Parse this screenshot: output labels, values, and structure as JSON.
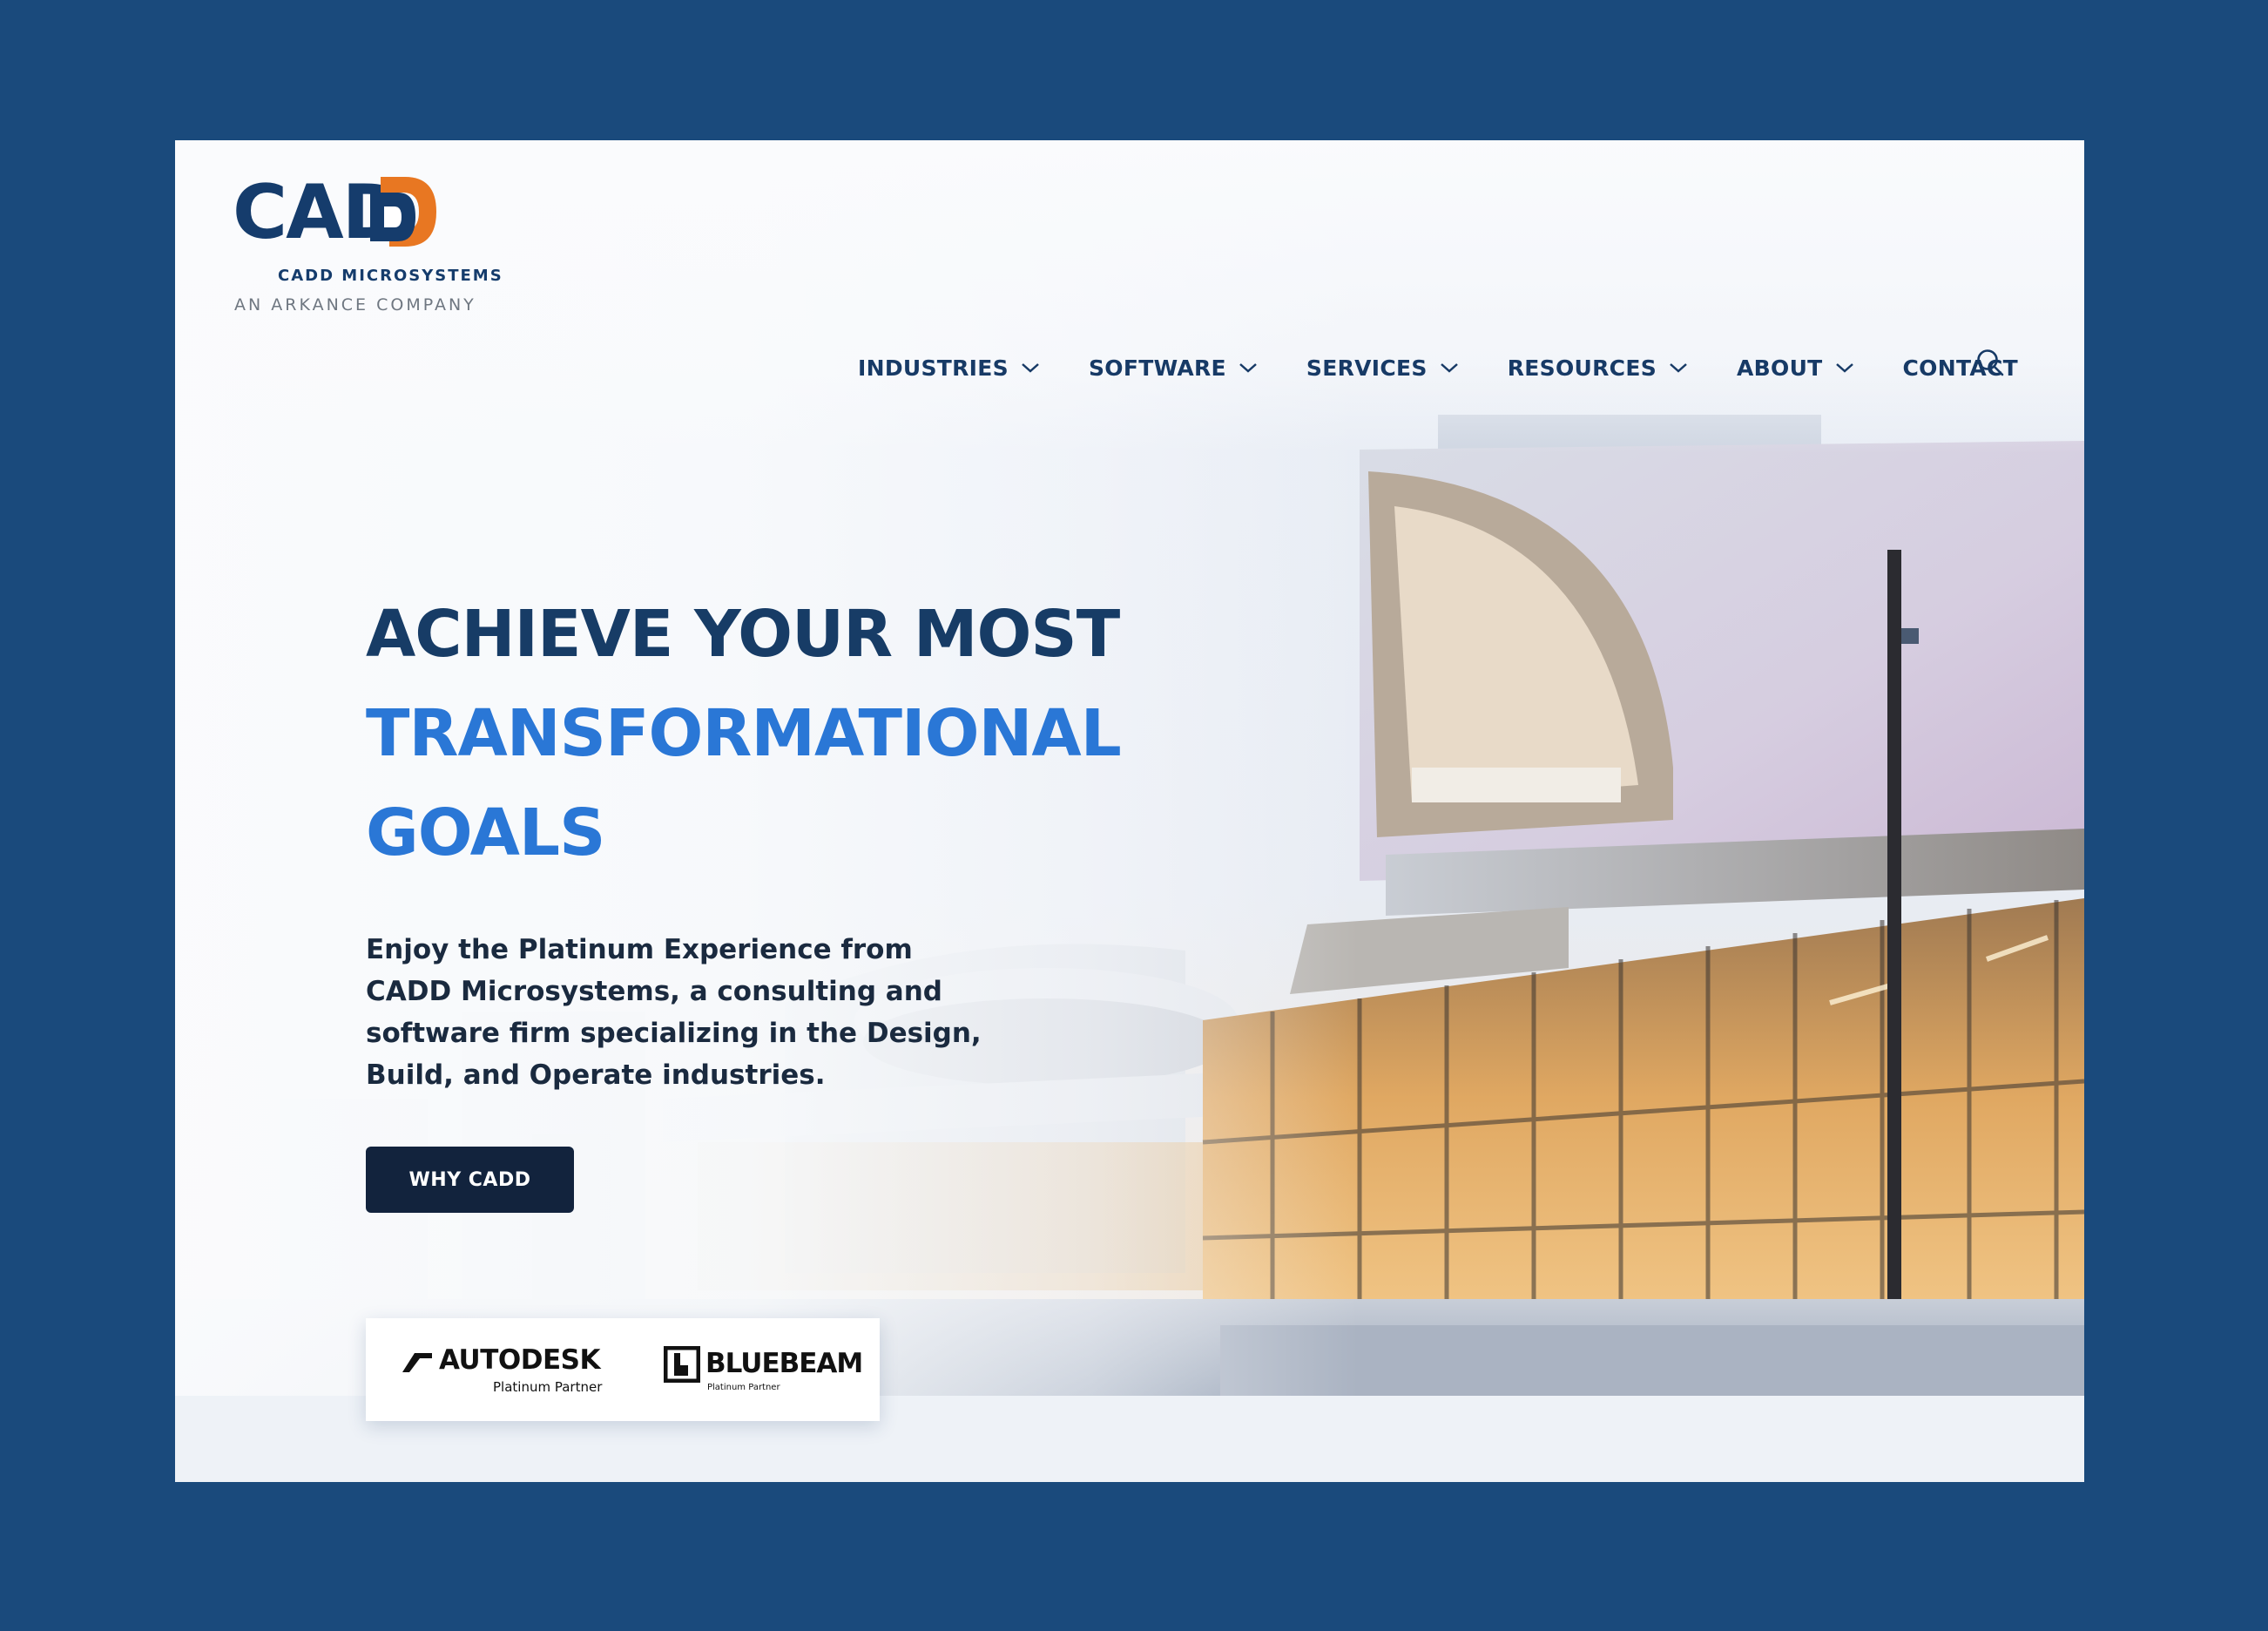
{
  "brand": {
    "logo_text": "CADD",
    "company": "CADD MICROSYSTEMS",
    "parent": "AN ARKANCE COMPANY",
    "colors": {
      "navy": "#153c6c",
      "orange": "#e87722",
      "accent_blue": "#2a77d6",
      "page_bg": "#1a4a7c"
    }
  },
  "nav": {
    "items": [
      {
        "label": "INDUSTRIES",
        "has_dropdown": true
      },
      {
        "label": "SOFTWARE",
        "has_dropdown": true
      },
      {
        "label": "SERVICES",
        "has_dropdown": true
      },
      {
        "label": "RESOURCES",
        "has_dropdown": true
      },
      {
        "label": "ABOUT",
        "has_dropdown": true
      },
      {
        "label": "CONTACT",
        "has_dropdown": false
      }
    ],
    "search_icon": "search-icon"
  },
  "hero": {
    "headline_line1": "ACHIEVE YOUR MOST",
    "headline_line2": "TRANSFORMATIONAL",
    "headline_line3": "GOALS",
    "lead": "Enjoy the Platinum Experience from CADD Microsystems, a consulting and software firm specializing in the Design, Build, and Operate industries.",
    "cta_label": "WHY CADD",
    "background_icon": "modern-building-photo"
  },
  "partners": [
    {
      "name": "AUTODESK",
      "tag": "Platinum Partner",
      "icon": "autodesk-logo-icon"
    },
    {
      "name": "BLUEBEAM",
      "tag": "Platinum Partner",
      "icon": "bluebeam-logo-icon"
    }
  ]
}
